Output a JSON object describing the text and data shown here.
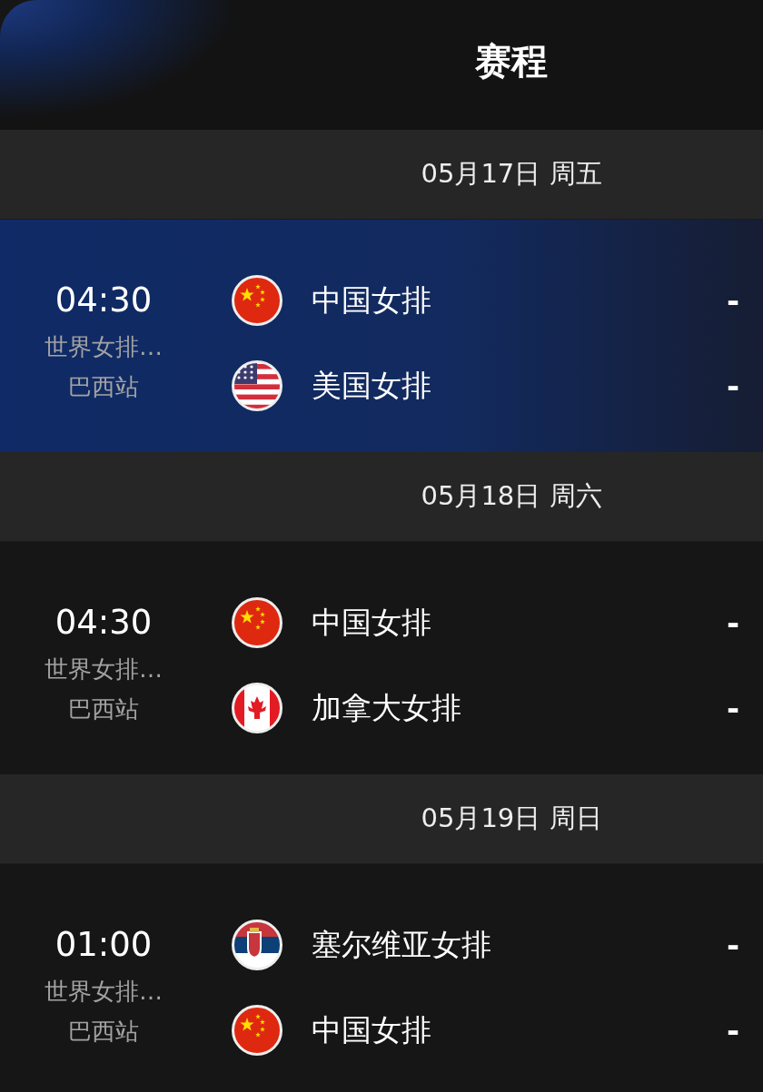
{
  "header": {
    "title": "赛程"
  },
  "days": [
    {
      "date": "05月17日 周五",
      "matches": [
        {
          "time": "04:30",
          "league": "世界女排…",
          "stage": "巴西站",
          "highlighted": true,
          "teams": [
            {
              "kind": "cn",
              "name": "中国女排",
              "score": "-"
            },
            {
              "kind": "us",
              "name": "美国女排",
              "score": "-"
            }
          ]
        }
      ]
    },
    {
      "date": "05月18日 周六",
      "matches": [
        {
          "time": "04:30",
          "league": "世界女排…",
          "stage": "巴西站",
          "highlighted": false,
          "teams": [
            {
              "kind": "cn",
              "name": "中国女排",
              "score": "-"
            },
            {
              "kind": "ca",
              "name": "加拿大女排",
              "score": "-"
            }
          ]
        }
      ]
    },
    {
      "date": "05月19日 周日",
      "matches": [
        {
          "time": "01:00",
          "league": "世界女排…",
          "stage": "巴西站",
          "highlighted": false,
          "teams": [
            {
              "kind": "rs",
              "name": "塞尔维亚女排",
              "score": "-"
            },
            {
              "kind": "cn",
              "name": "中国女排",
              "score": "-"
            }
          ]
        }
      ]
    }
  ]
}
